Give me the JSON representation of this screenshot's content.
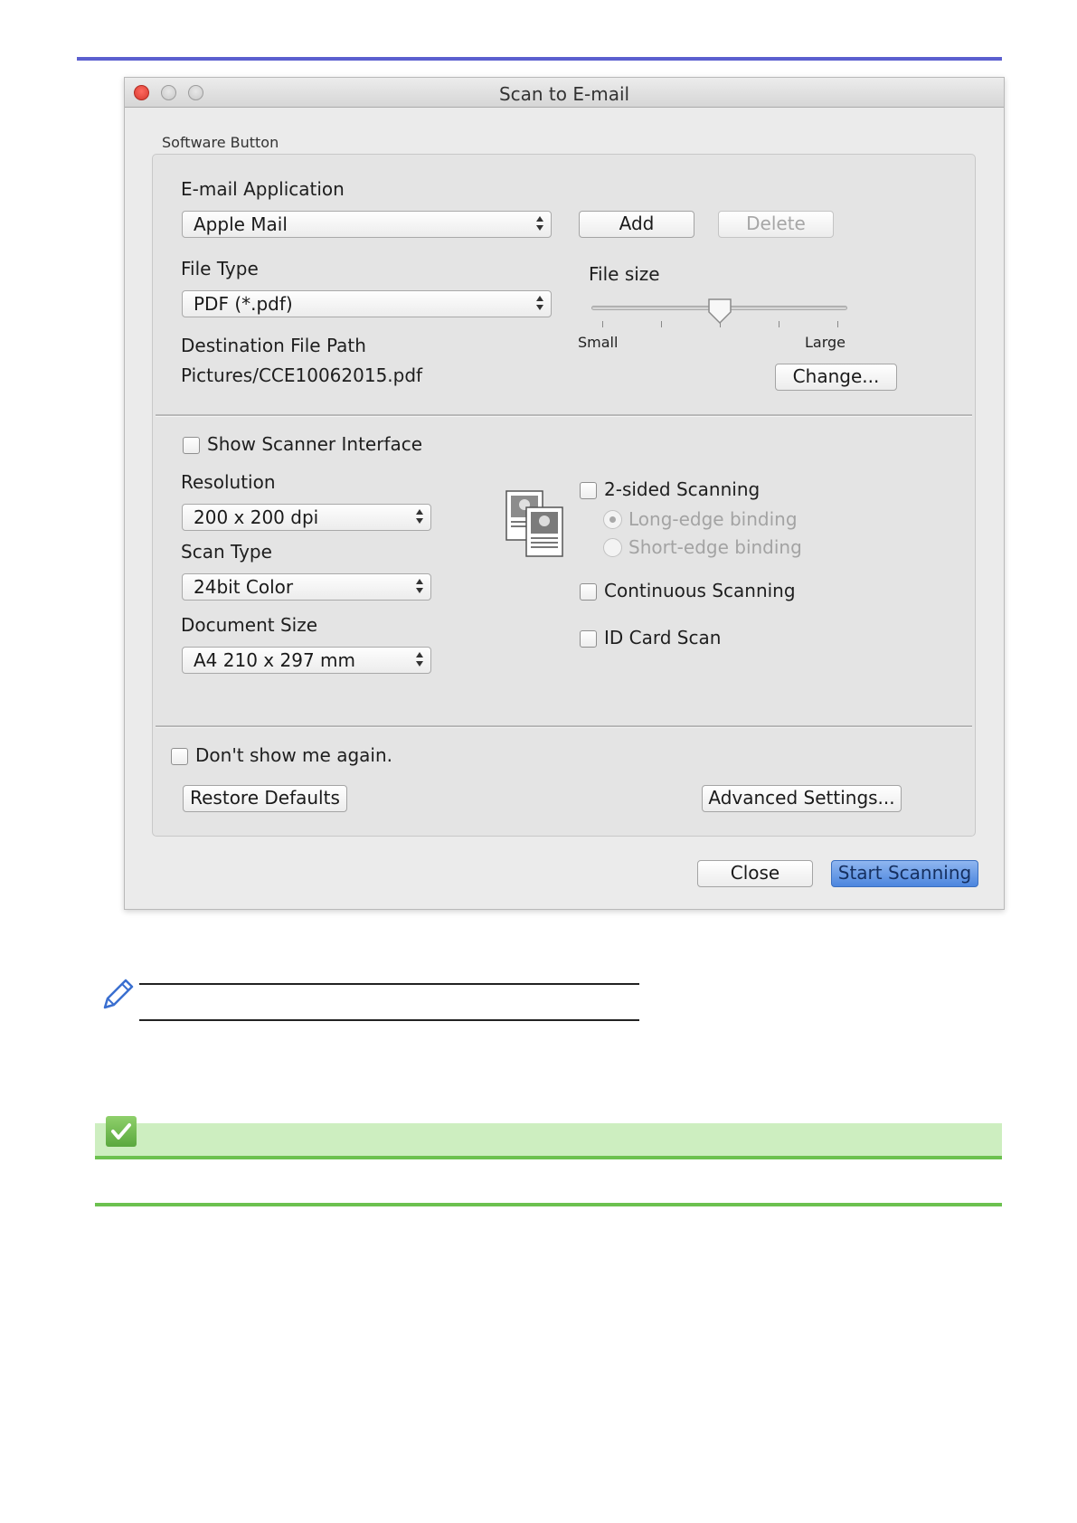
{
  "window": {
    "title": "Scan to E-mail"
  },
  "software_button": {
    "group_label": "Software Button",
    "email_app": {
      "label": "E-mail Application",
      "value": "Apple Mail",
      "add_label": "Add",
      "delete_label": "Delete"
    },
    "file_type": {
      "label": "File Type",
      "value": "PDF (*.pdf)"
    },
    "file_size": {
      "label": "File size",
      "min_label": "Small",
      "max_label": "Large",
      "level": 0.5
    },
    "destination": {
      "label": "Destination File Path",
      "value": "Pictures/CCE10062015.pdf",
      "change_label": "Change..."
    },
    "show_scanner_interface": "Show Scanner Interface",
    "resolution": {
      "label": "Resolution",
      "value": "200 x 200 dpi"
    },
    "scan_type": {
      "label": "Scan Type",
      "value": "24bit Color"
    },
    "document_size": {
      "label": "Document Size",
      "value": "A4 210 x 297 mm"
    },
    "two_sided": "2-sided Scanning",
    "long_edge": "Long-edge binding",
    "short_edge": "Short-edge binding",
    "continuous": "Continuous Scanning",
    "id_card": "ID Card Scan",
    "dont_show": "Don't show me again.",
    "restore_label": "Restore Defaults",
    "advanced_label": "Advanced Settings..."
  },
  "footer": {
    "close_label": "Close",
    "start_label": "Start Scanning"
  },
  "icons": {
    "scan_preview": "scan-preview-icon",
    "note": "pencil-icon",
    "check": "check-icon"
  }
}
